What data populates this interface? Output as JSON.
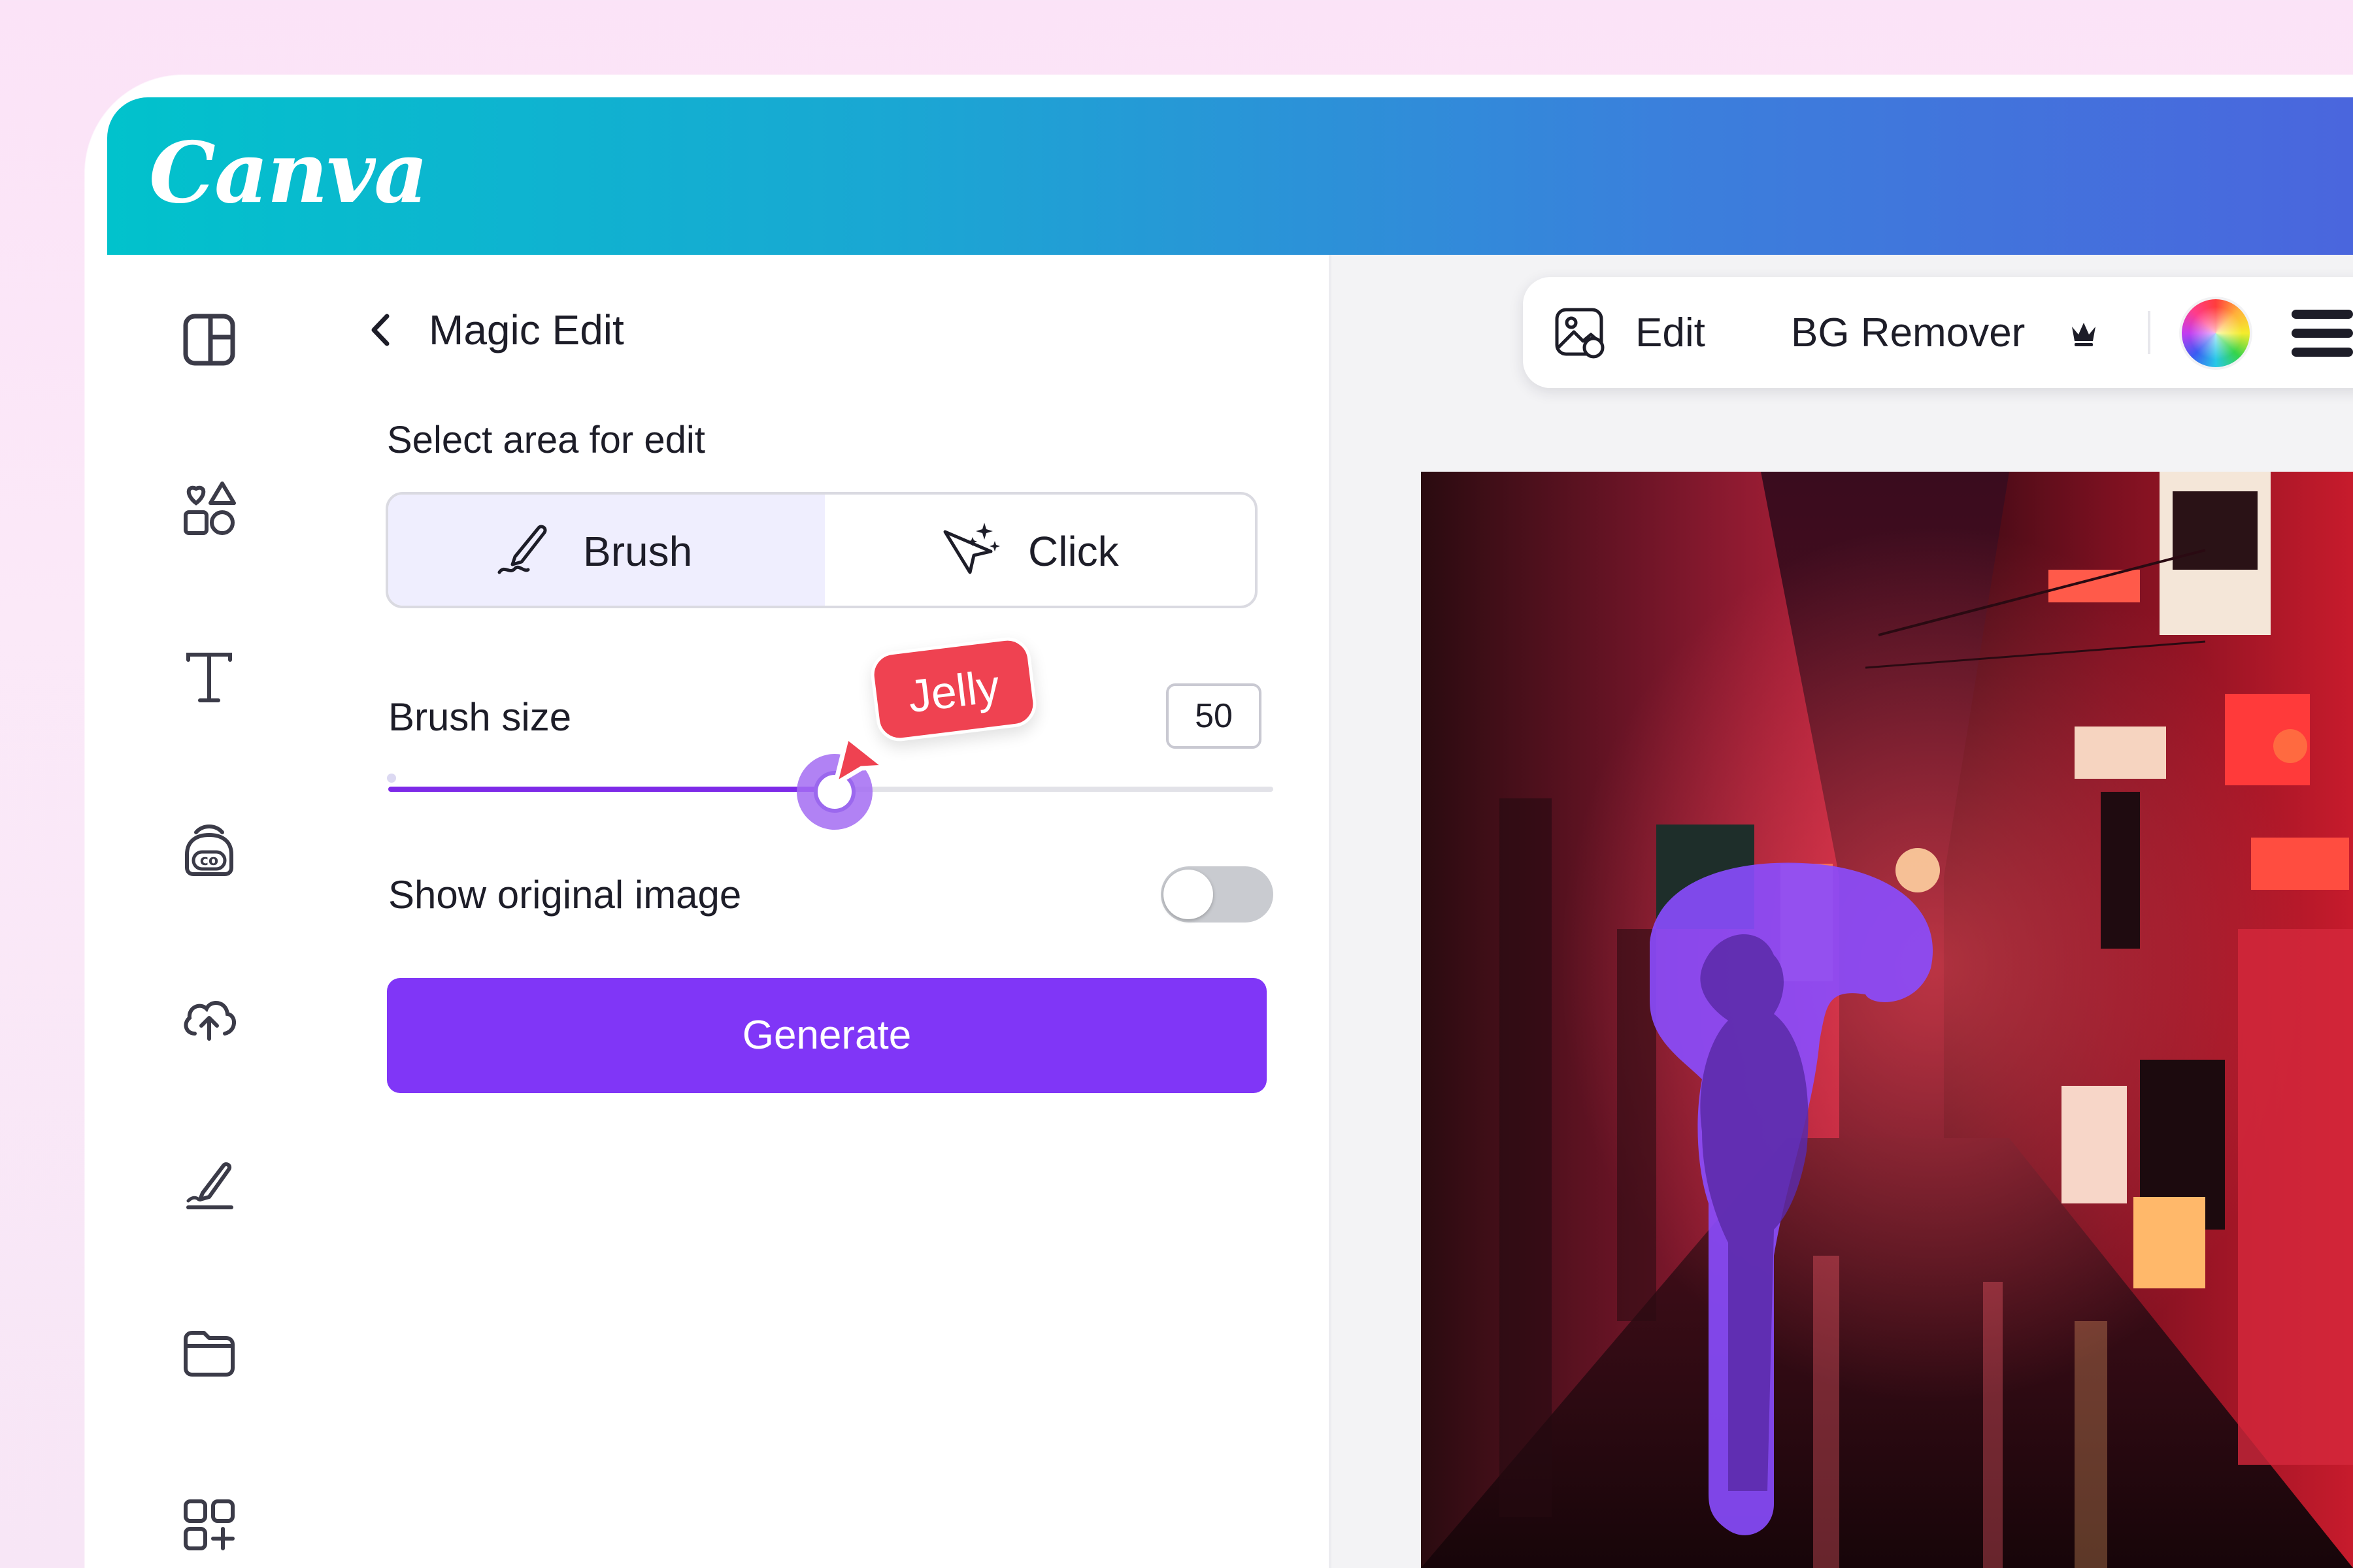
{
  "app": {
    "logo_text": "Canva"
  },
  "panel": {
    "title": "Magic Edit",
    "select_area_label": "Select area for edit",
    "modes": [
      {
        "label": "Brush",
        "icon": "brush-icon",
        "selected": true
      },
      {
        "label": "Click",
        "icon": "sparkle-cursor-icon",
        "selected": false
      }
    ],
    "brush_size": {
      "label": "Brush size",
      "value": "50",
      "fraction": 0.5
    },
    "collaborator_tag": "Jelly",
    "show_original": {
      "label": "Show original image",
      "enabled": false
    },
    "generate_label": "Generate"
  },
  "toolbar": {
    "edit_label": "Edit",
    "bg_remover_label": "BG Remover"
  },
  "sidebar": {
    "icons": [
      "layout-icon",
      "elements-icon",
      "text-icon",
      "brand-icon",
      "uploads-icon",
      "draw-icon",
      "projects-icon",
      "apps-icon"
    ]
  },
  "colors": {
    "header_start": "#01c2cc",
    "header_end": "#4a66dd",
    "accent": "#8036f7",
    "jelly_tag": "#ef4251",
    "selection_overlay": "#8a4dff"
  }
}
